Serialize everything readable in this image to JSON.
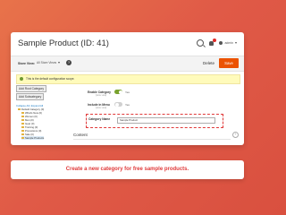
{
  "header": {
    "title": "Sample Product (ID: 41)",
    "notification_count": "",
    "admin_label": "admin"
  },
  "toolbar": {
    "store_view_label": "Store View:",
    "store_view_value": "All Store Views",
    "help": "?",
    "delete_label": "Delete",
    "save_label": "Save"
  },
  "notice": {
    "text": "This is the default configuration scope."
  },
  "left": {
    "add_root_category": "Add Root Category",
    "add_subcategory": "Add Subcategory",
    "tree_links": "Collapse All | Expand All",
    "tree_items": [
      "Default Category (0)",
      "What's New (0)",
      "Women (0)",
      "Men (0)",
      "Gear (0)",
      "Training (0)",
      "Promotions (0)",
      "Sale (0)",
      "Sample Products"
    ]
  },
  "form": {
    "enable_label": "Enable Category",
    "enable_scope": "[store view]",
    "enable_value": "Yes",
    "menu_label": "Include in Menu",
    "menu_scope": "[store view]",
    "menu_value": "Yes",
    "name_label": "Category Name",
    "name_value": "Sample Product",
    "content_label": "Content",
    "expand": "+"
  },
  "caption": "Create a new category for free sample products.",
  "colors": {
    "accent": "#eb5202",
    "highlight": "#e03a3a",
    "background": "#e05a47"
  }
}
